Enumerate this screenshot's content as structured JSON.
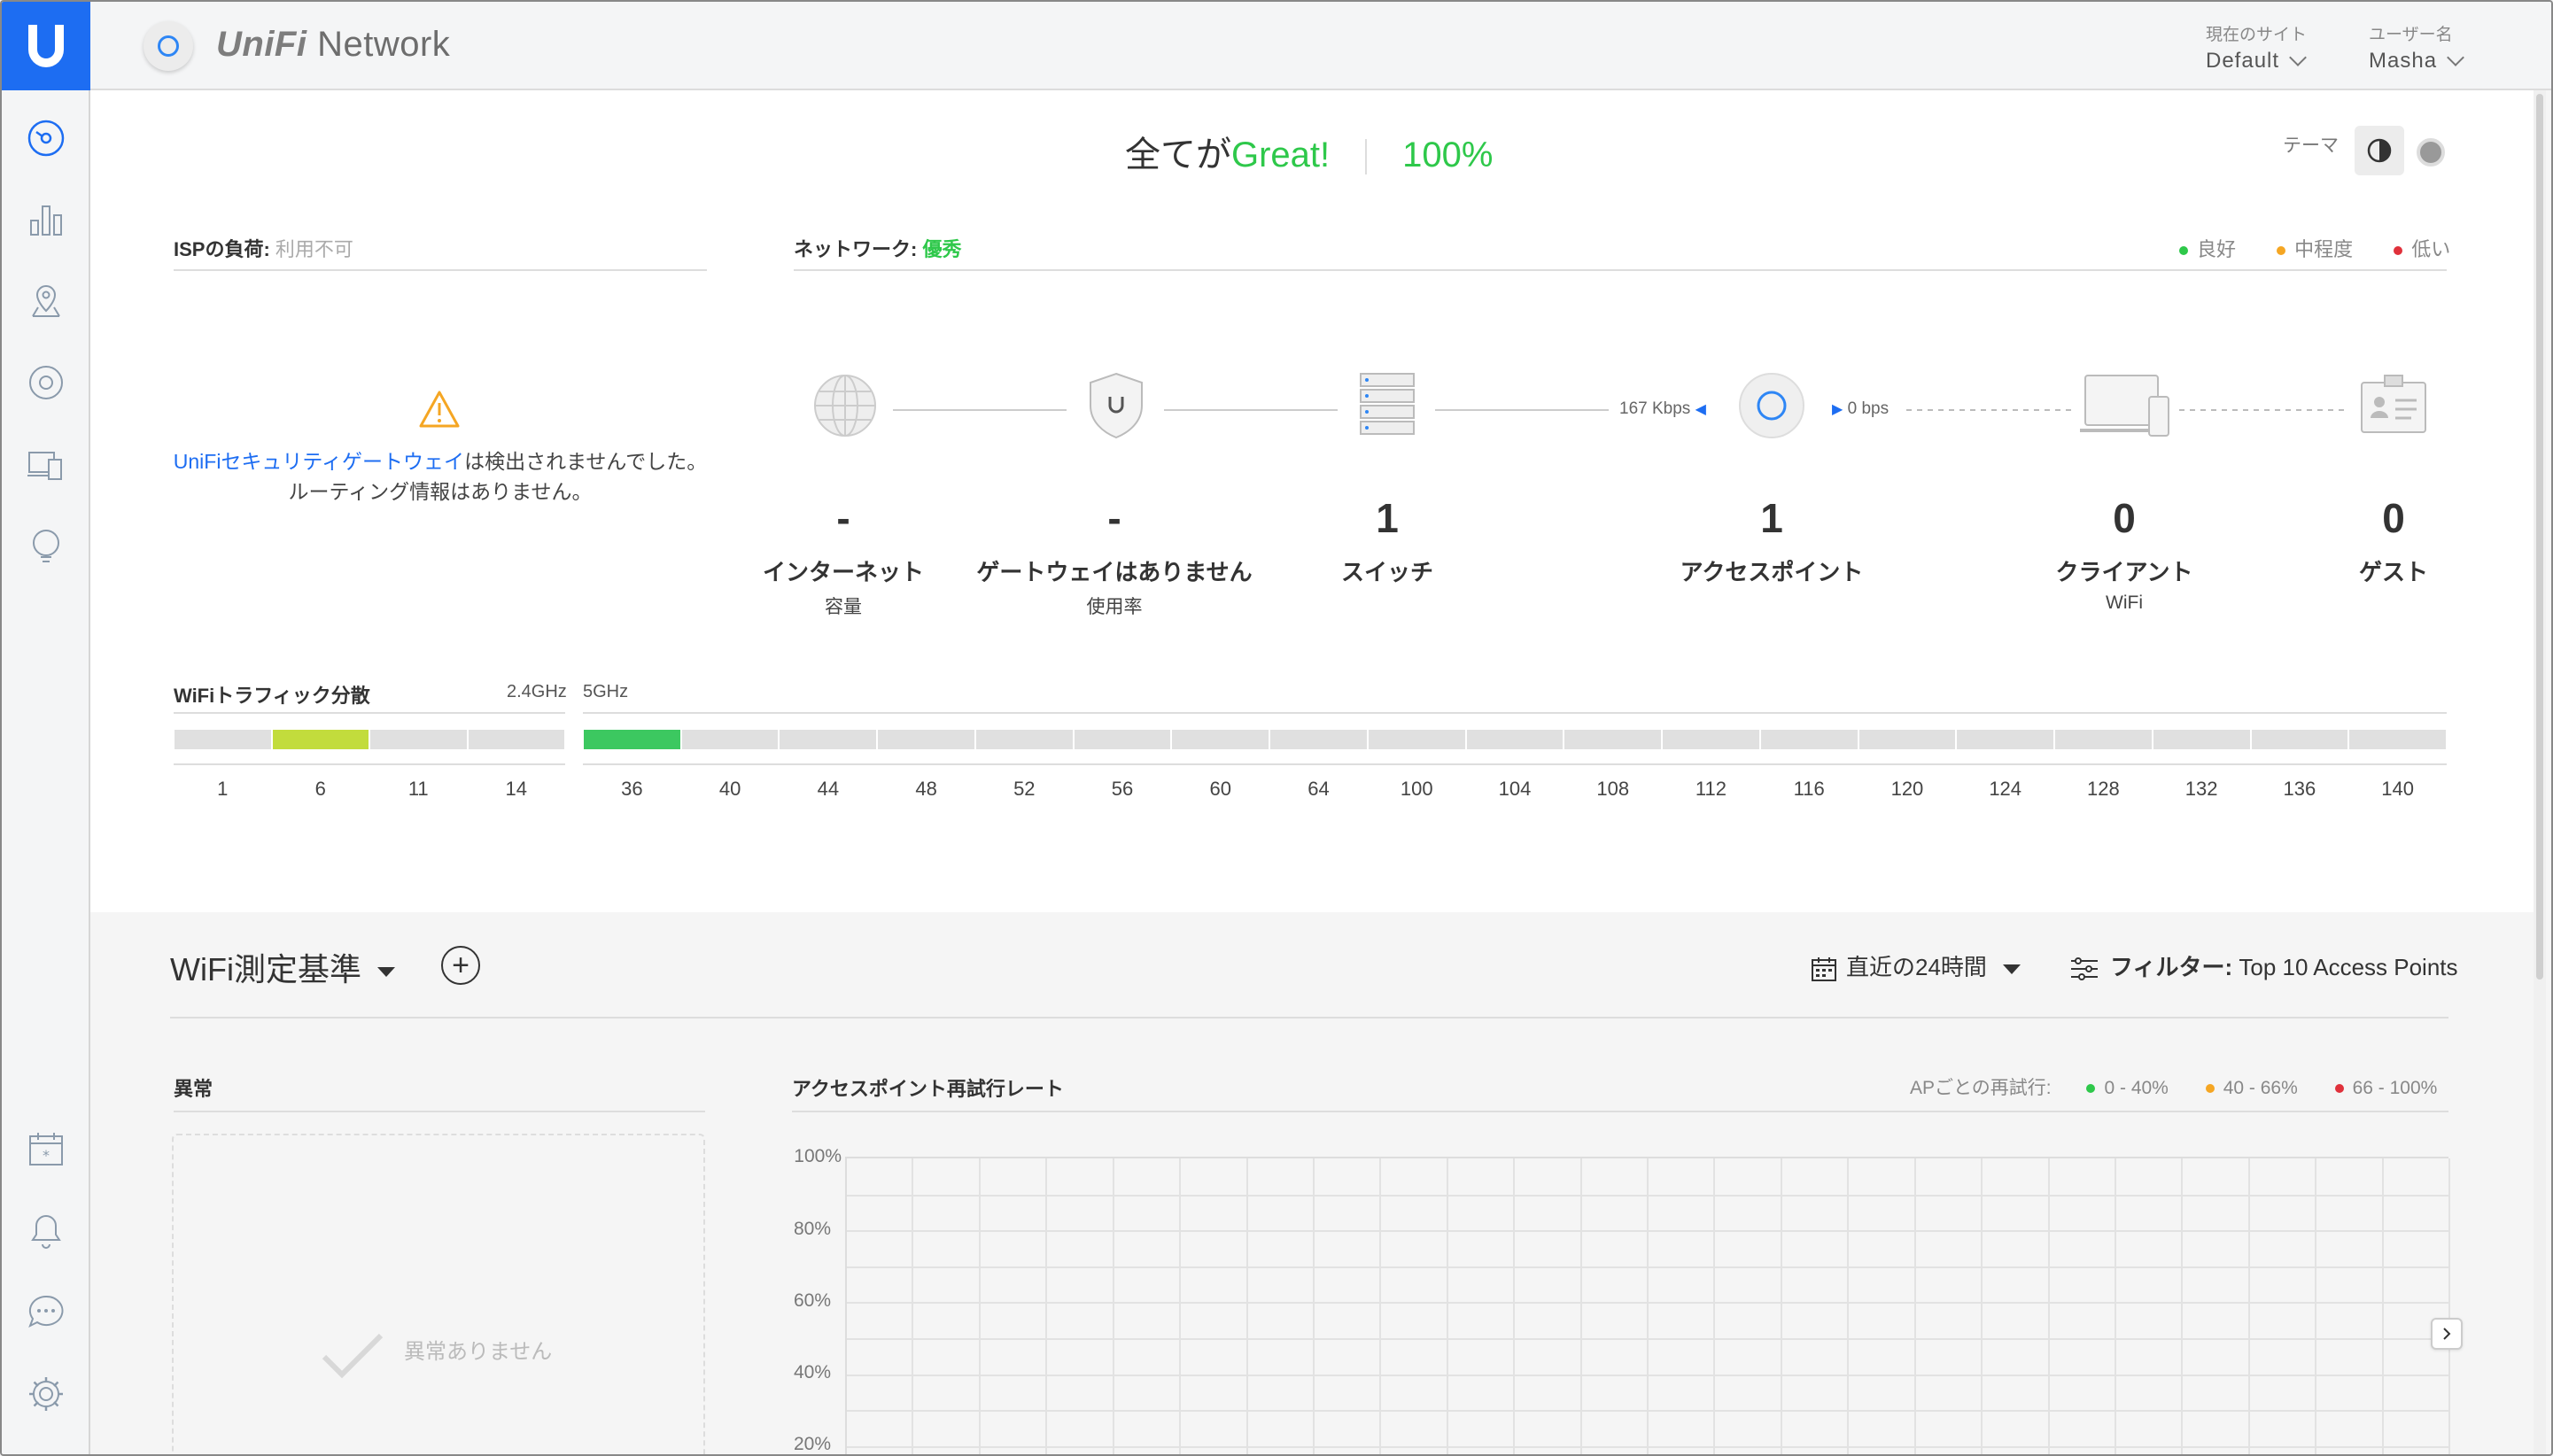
{
  "header": {
    "brand_prefix": "UniFi",
    "brand_suffix": "Network",
    "site_label": "現在のサイト",
    "site_value": "Default",
    "user_label": "ユーザー名",
    "user_value": "Masha"
  },
  "sidebar": {
    "items": [
      "dashboard-icon",
      "statistics-icon",
      "map-icon",
      "devices-icon",
      "clients-icon",
      "insights-icon",
      "events-icon",
      "alerts-icon",
      "chat-icon",
      "settings-icon"
    ]
  },
  "summary": {
    "prefix": "全てが",
    "status": "Great!",
    "percent": "100%",
    "theme_label": "テーマ"
  },
  "isp": {
    "label": "ISPの負荷:",
    "value": "利用不可"
  },
  "network": {
    "label": "ネットワーク:",
    "value": "優秀",
    "legend": [
      "良好",
      "中程度",
      "低い"
    ]
  },
  "legend_colors": {
    "good": "#2ec84a",
    "medium": "#f5a623",
    "low": "#e0313b"
  },
  "warning": {
    "link": "UniFiセキュリティゲートウェイ",
    "text": "は検出されませんでした。ルーティング情報はありません。"
  },
  "topology": {
    "upload_rate": "167 Kbps",
    "download_rate": "0 bps",
    "metrics": [
      {
        "num": "-",
        "name": "インターネット",
        "sub": "容量"
      },
      {
        "num": "-",
        "name": "ゲートウェイはありません",
        "sub": "使用率"
      },
      {
        "num": "1",
        "name": "スイッチ",
        "sub": ""
      },
      {
        "num": "1",
        "name": "アクセスポイント",
        "sub": ""
      },
      {
        "num": "0",
        "name": "クライアント",
        "sub": "WiFi"
      },
      {
        "num": "0",
        "name": "ゲスト",
        "sub": ""
      }
    ]
  },
  "wifi_traffic": {
    "title": "WiFiトラフィック分散",
    "band_24": "2.4GHz",
    "band_5": "5GHz",
    "channels_24": [
      "1",
      "6",
      "11",
      "14"
    ],
    "channels_5": [
      "36",
      "40",
      "44",
      "48",
      "52",
      "56",
      "60",
      "64",
      "100",
      "104",
      "108",
      "112",
      "116",
      "120",
      "124",
      "128",
      "132",
      "136",
      "140"
    ],
    "active_24": "6",
    "active_5": "36",
    "active_24_color": "#c2dc3c",
    "active_5_color": "#3cc860"
  },
  "lower": {
    "title": "WiFi測定基準",
    "range": "直近の24時間",
    "filter_label": "フィルター:",
    "filter_value": "Top 10 Access Points",
    "anomalies_title": "異常",
    "no_anomalies": "異常ありません",
    "retry_title": "アクセスポイント再試行レート",
    "retry_legend_label": "APごとの再試行:",
    "retry_legend": [
      "0 - 40%",
      "40 - 66%",
      "66 - 100%"
    ],
    "y_ticks": [
      "100%",
      "80%",
      "60%",
      "40%",
      "20%"
    ]
  }
}
